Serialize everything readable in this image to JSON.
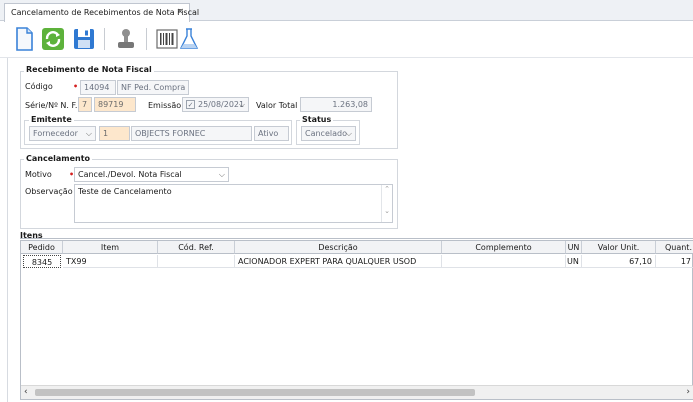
{
  "tab": {
    "title": "Cancelamento de Recebimentos de Nota Fiscal",
    "close": "×"
  },
  "toolbar": {
    "buttons": [
      {
        "icon": "new-document-icon"
      },
      {
        "icon": "refresh-icon"
      },
      {
        "icon": "save-icon"
      },
      {
        "icon": "stamp-icon"
      },
      {
        "icon": "barcode-icon"
      },
      {
        "icon": "flask-icon"
      }
    ]
  },
  "receipt": {
    "legend": "Recebimento de Nota Fiscal",
    "codigo_label": "Código",
    "codigo_value": "14094",
    "nf_ped_compra_placeholder": "NF Ped. Compra",
    "serie_label": "Série/Nº N. F.",
    "serie_value": "7",
    "numero_value": "89719",
    "emissao_label": "Emissão",
    "emissao_value": "25/08/2021",
    "valor_total_label": "Valor Total",
    "valor_total_value": "1.263,08",
    "emitente": {
      "legend": "Emitente",
      "tipo_value": "Fornecedor",
      "codigo_value": "1",
      "nome_value": "OBJECTS FORNEC",
      "situacao_value": "Ativo"
    },
    "status": {
      "legend": "Status",
      "value": "Cancelado"
    }
  },
  "cancel": {
    "legend": "Cancelamento",
    "motivo_label": "Motivo",
    "motivo_value": "Cancel./Devol. Nota Fiscal",
    "observacao_label": "Observação",
    "observacao_value": "Teste de Cancelamento"
  },
  "items": {
    "legend": "Itens",
    "columns": [
      "Pedido",
      "Item",
      "Cód. Ref.",
      "Descrição",
      "Complemento",
      "UN",
      "Valor Unit.",
      "Quant."
    ],
    "rows": [
      {
        "pedido": "8345",
        "item": "TX99",
        "cod_ref": "",
        "descricao": "ACIONADOR EXPERT PARA QUALQUER USOD",
        "complemento": "",
        "un": "UN",
        "valor_unit": "67,10",
        "quant": "17"
      }
    ]
  },
  "colors": {
    "required": "#d42020",
    "peach": "#fde7cc",
    "accent": "#2b7bd6"
  }
}
